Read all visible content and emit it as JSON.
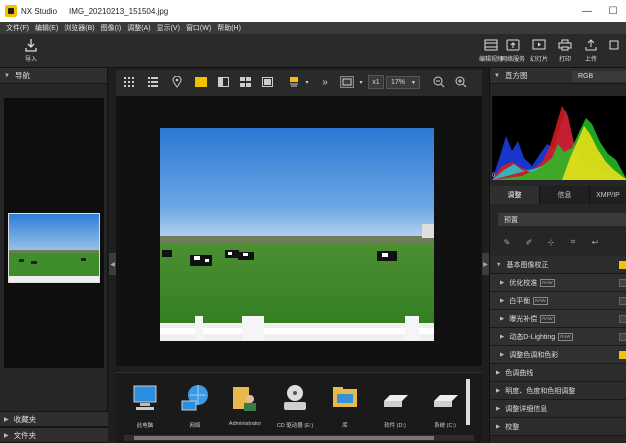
{
  "window": {
    "app_name": "NX Studio",
    "file_name": "IMG_20210213_151504.jpg",
    "controls": [
      "—",
      "☐"
    ]
  },
  "menu": [
    "文件(F)",
    "编辑(E)",
    "浏览器(B)",
    "图像(I)",
    "调整(A)",
    "显示(V)",
    "窗口(W)",
    "帮助(H)"
  ],
  "toolbar": {
    "import_label": "导入",
    "right_items": [
      {
        "label": "编辑视频",
        "icon": "film-edit-icon"
      },
      {
        "label": "网络服务",
        "icon": "upload-cloud-icon"
      },
      {
        "label": "幻灯片",
        "icon": "slideshow-icon"
      },
      {
        "label": "打印",
        "icon": "printer-icon"
      },
      {
        "label": "上传",
        "icon": "upload-icon"
      },
      {
        "label": "",
        "icon": "more-icon"
      }
    ]
  },
  "left_panel": {
    "nav_title": "导航",
    "bottom_sections": [
      "收藏夹",
      "文件夹"
    ]
  },
  "viewer_toolbar": {
    "zoom_level": "17%",
    "multiplier": "x1",
    "arrows": "»"
  },
  "filmstrip": {
    "items": [
      {
        "label": "此电脑",
        "icon": "computer-icon"
      },
      {
        "label": "网络",
        "icon": "network-globe-icon"
      },
      {
        "label": "Administrator",
        "icon": "user-folder-icon"
      },
      {
        "label": "CD 驱动器 (E:)",
        "icon": "cd-drive-icon"
      },
      {
        "label": "库",
        "icon": "library-folder-icon"
      },
      {
        "label": "软件 (D:)",
        "icon": "drive-d-icon"
      },
      {
        "label": "系统 (C:)",
        "icon": "drive-c-icon"
      }
    ]
  },
  "right_panel": {
    "histogram_title": "直方图",
    "channel": "RGB",
    "histogram_marker": "0",
    "tabs": [
      "调整",
      "信息",
      "XMP/IP"
    ],
    "preset": "预置",
    "section_title": "基本图像校正",
    "rows": [
      {
        "label": "优化校准",
        "tag": "RAW",
        "checked": false
      },
      {
        "label": "白平衡",
        "tag": "RAW",
        "checked": false
      },
      {
        "label": "曝光补偿",
        "tag": "RAW",
        "checked": false
      },
      {
        "label": "动态D-Lighting",
        "tag": "RAW",
        "checked": false
      },
      {
        "label": "调整色调和色彩",
        "tag": "",
        "checked": true
      }
    ],
    "collapsed_sections": [
      "色调曲线",
      "明度、色度和色相调整",
      "调整详细信息",
      "校整"
    ]
  },
  "colors": {
    "accent": "#f3c100",
    "background": "#1e1e1e",
    "sky": "#3c8be0",
    "grass": "#3d8a2a"
  }
}
